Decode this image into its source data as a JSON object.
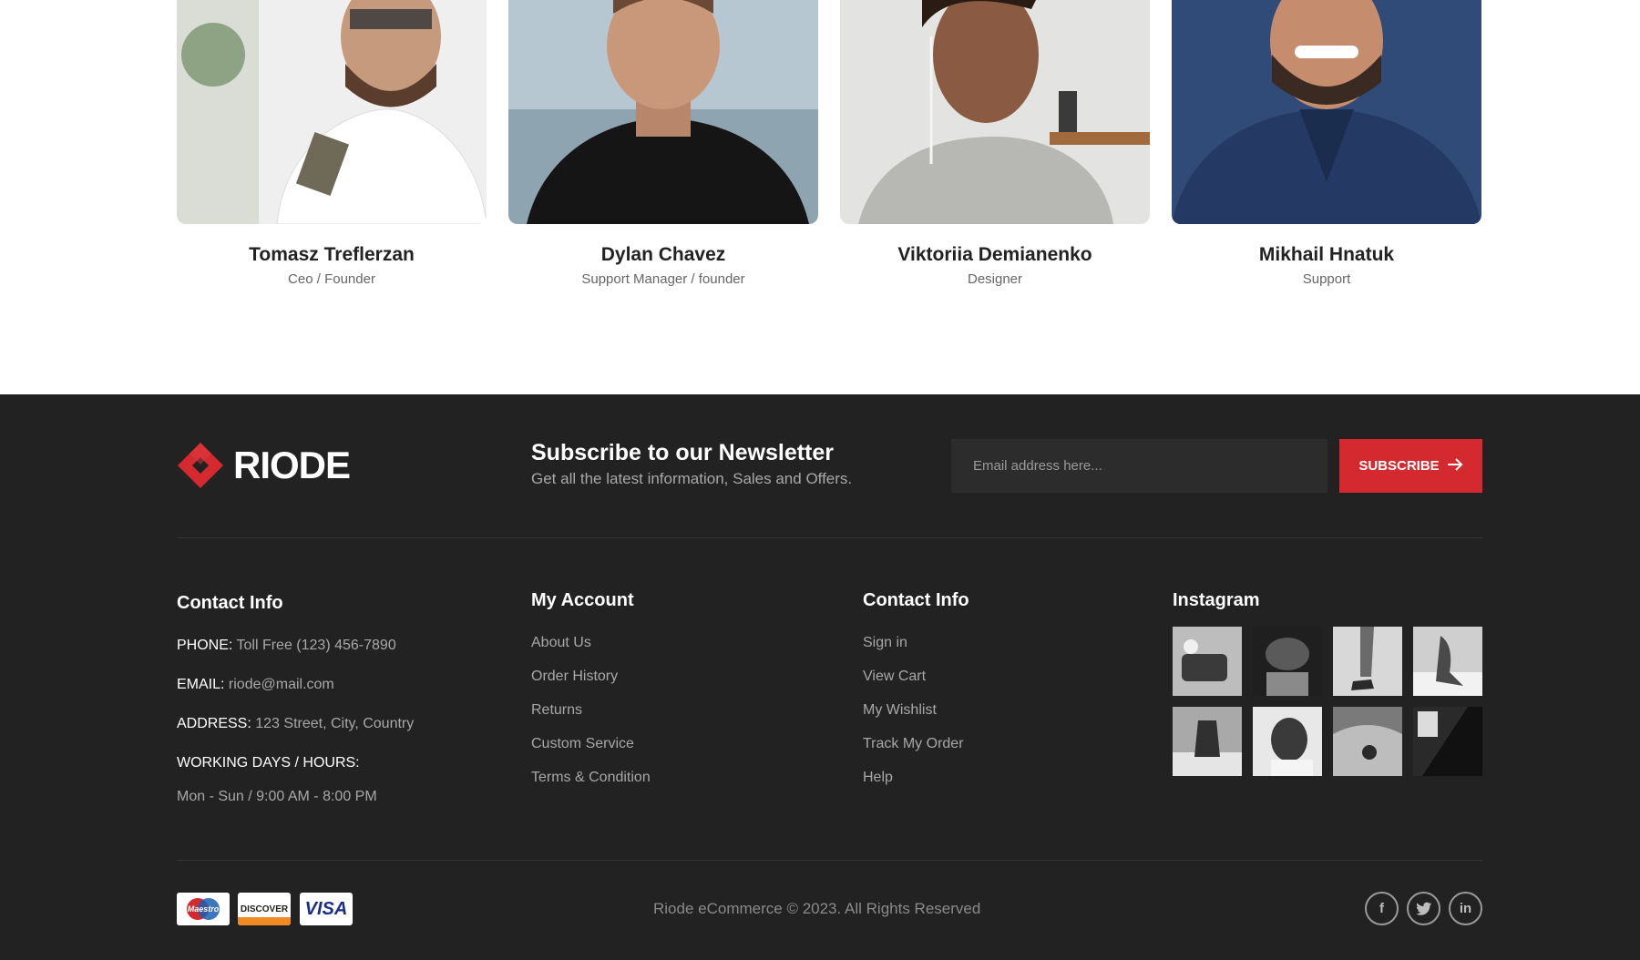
{
  "team": {
    "members": [
      {
        "name": "Tomasz Treflerzan",
        "role": "Ceo / Founder"
      },
      {
        "name": "Dylan Chavez",
        "role": "Support Manager / founder"
      },
      {
        "name": "Viktoriia Demianenko",
        "role": "Designer"
      },
      {
        "name": "Mikhail Hnatuk",
        "role": "Support"
      }
    ]
  },
  "footer": {
    "logo_text": "RIODE",
    "newsletter": {
      "title": "Subscribe to our Newsletter",
      "subtitle": "Get all the latest information, Sales and Offers.",
      "email_placeholder": "Email address here...",
      "subscribe_label": "SUBSCRIBE"
    },
    "contact": {
      "title": "Contact Info",
      "phone_label": "PHONE:",
      "phone_value": "Toll Free (123) 456-7890",
      "email_label": "EMAIL:",
      "email_value": "riode@mail.com",
      "address_label": "ADDRESS:",
      "address_value": "123 Street, City, Country",
      "hours_label": "WORKING DAYS / HOURS:",
      "hours_value": "Mon - Sun / 9:00 AM - 8:00 PM"
    },
    "my_account": {
      "title": "My Account",
      "links": [
        "About Us",
        "Order History",
        "Returns",
        "Custom Service",
        "Terms & Condition"
      ]
    },
    "contact_links": {
      "title": "Contact Info",
      "links": [
        "Sign in",
        "View Cart",
        "My Wishlist",
        "Track My Order",
        "Help"
      ]
    },
    "instagram": {
      "title": "Instagram"
    },
    "payments": {
      "maestro": "Maestro",
      "discover": "DISCOVER",
      "visa": "VISA"
    },
    "copyright": "Riode eCommerce © 2023. All Rights Reserved",
    "social": {
      "facebook": "f",
      "twitter": "t",
      "linkedin": "in"
    }
  },
  "colors": {
    "accent": "#d42a2f",
    "footer_bg": "#222222"
  },
  "icons": [
    "logo-diamond-icon",
    "arrow-right-icon",
    "facebook-icon",
    "twitter-icon",
    "linkedin-icon"
  ]
}
